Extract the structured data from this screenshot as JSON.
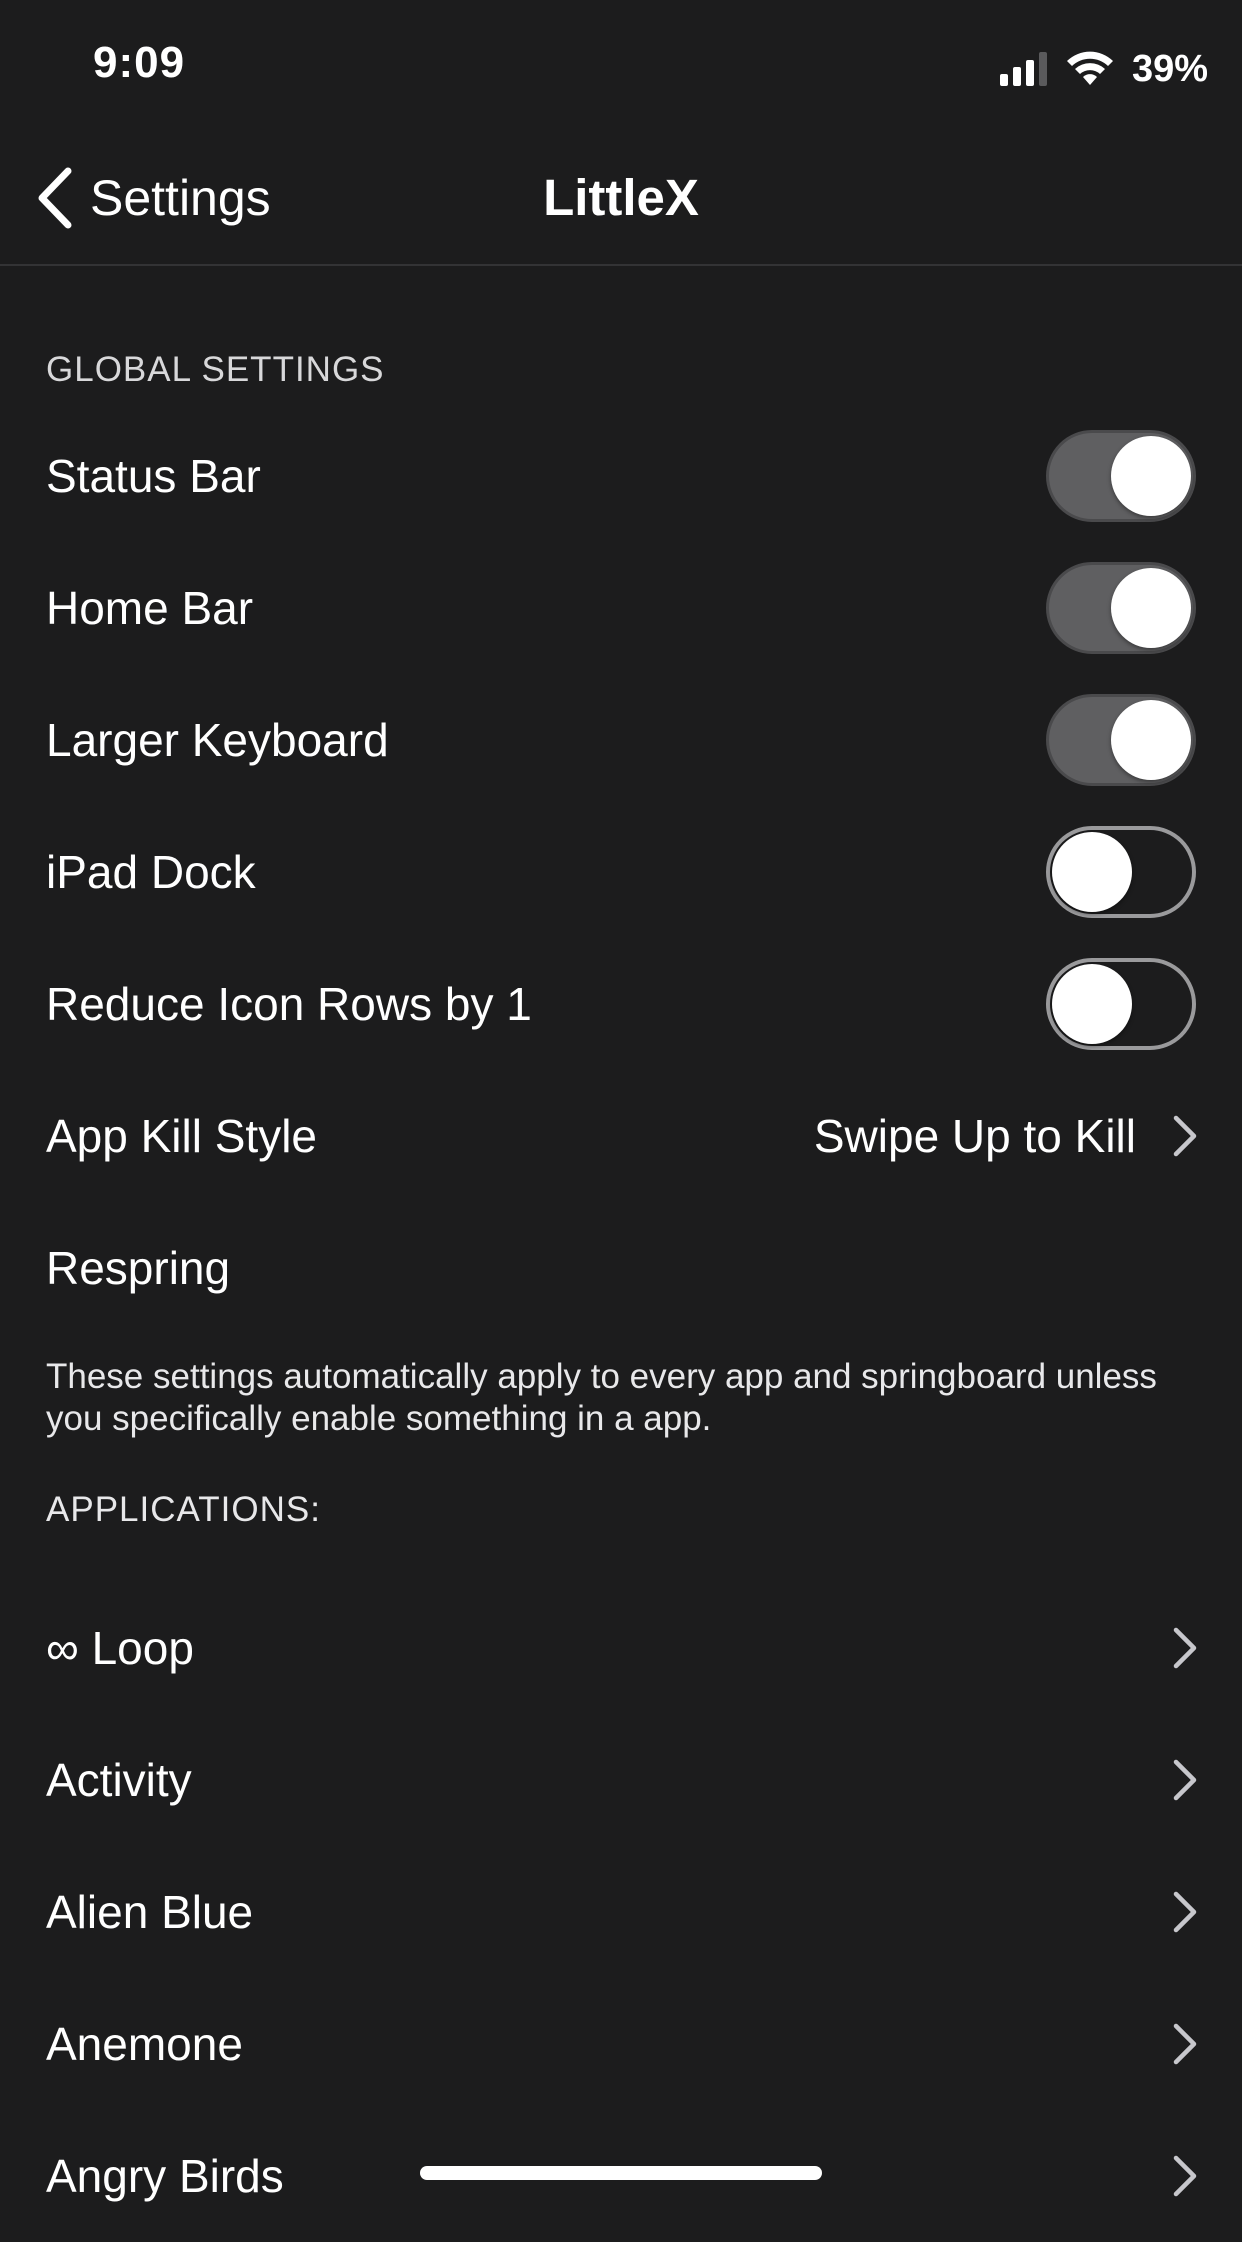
{
  "status_bar": {
    "time": "9:09",
    "battery": "39%",
    "icons": [
      "signal-icon",
      "wifi-icon"
    ]
  },
  "nav": {
    "back_label": "Settings",
    "title": "LittleX",
    "back_icon": "chevron-left-icon"
  },
  "global": {
    "header": "GLOBAL SETTINGS",
    "rows": [
      {
        "label": "Status Bar",
        "toggle": true
      },
      {
        "label": "Home Bar",
        "toggle": true
      },
      {
        "label": "Larger Keyboard",
        "toggle": true
      },
      {
        "label": "iPad Dock",
        "toggle": false
      },
      {
        "label": "Reduce Icon Rows by 1",
        "toggle": false
      }
    ],
    "kill_style": {
      "label": "App Kill Style",
      "value": "Swipe Up to Kill"
    },
    "respring": {
      "label": "Respring"
    },
    "footer": "These settings automatically apply to every app and springboard unless you specifically enable something in a app."
  },
  "applications": {
    "header": "APPLICATIONS:",
    "items": [
      {
        "label": "∞ Loop"
      },
      {
        "label": "Activity"
      },
      {
        "label": "Alien Blue"
      },
      {
        "label": "Anemone"
      },
      {
        "label": "Angry Birds"
      }
    ]
  },
  "colors": {
    "background": "#1c1c1d",
    "toggle_on": "#5f5f61",
    "toggle_off_border": "#9a9a9c",
    "text": "#ffffff"
  }
}
